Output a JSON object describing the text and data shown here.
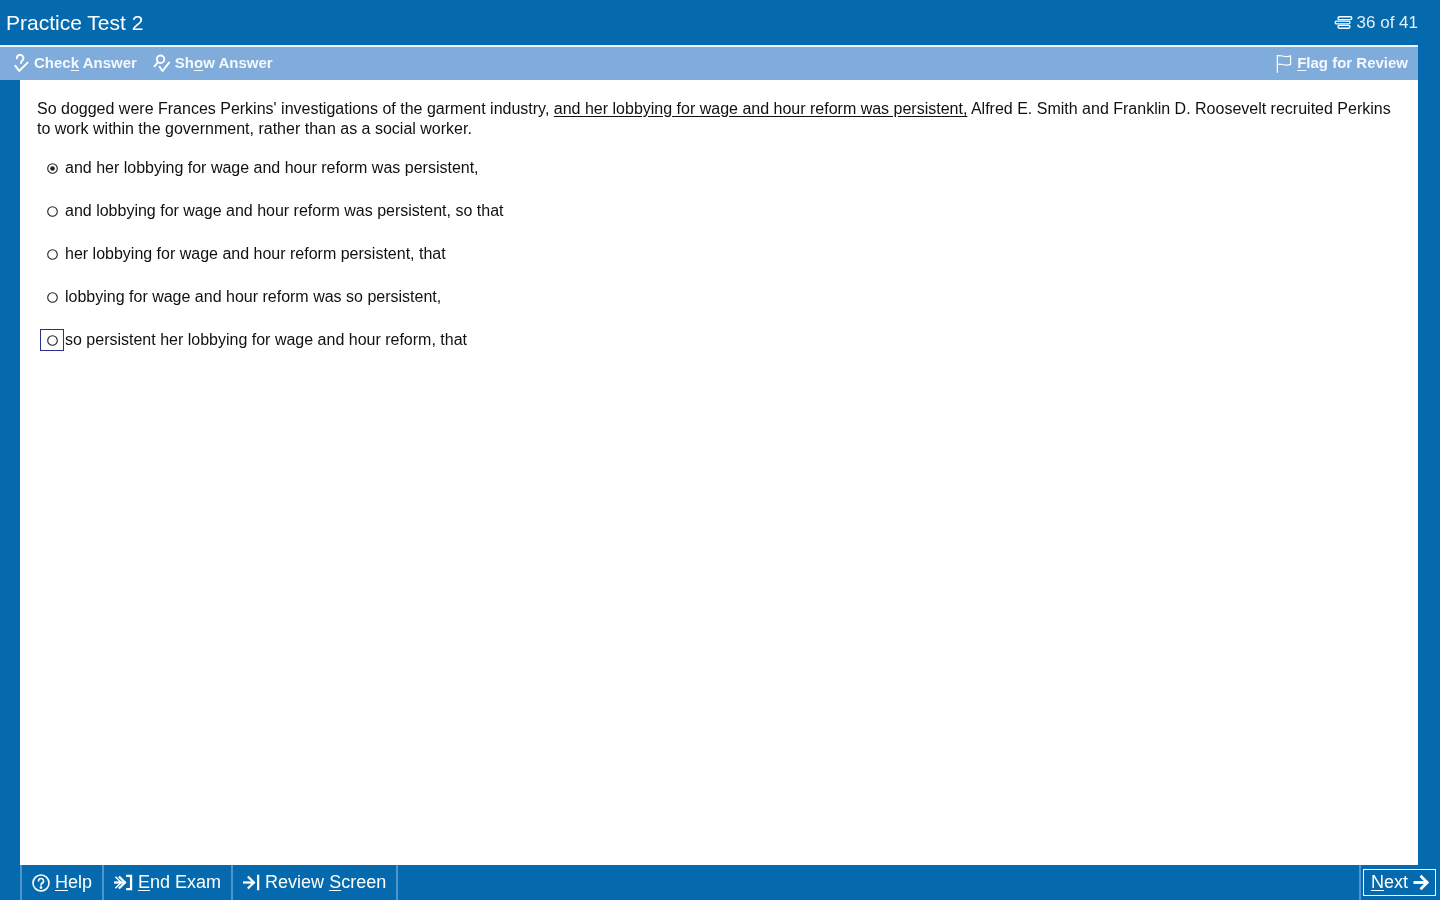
{
  "window": {
    "title": "Practice Test 2",
    "counter": "36 of 41"
  },
  "toolbar": {
    "left": [
      {
        "kind": "check",
        "label_parts": [
          {
            "text": "Chec",
            "underlined": false
          },
          {
            "text": "k",
            "underlined": true
          },
          {
            "text": " Answer",
            "underlined": false
          }
        ]
      },
      {
        "kind": "show",
        "label_parts": [
          {
            "text": "Sh",
            "underlined": false
          },
          {
            "text": "o",
            "underlined": true
          },
          {
            "text": "w Answer",
            "underlined": false
          }
        ]
      }
    ],
    "right": [
      {
        "kind": "flag",
        "label_parts": [
          {
            "text": "F",
            "underlined": true
          },
          {
            "text": "lag for Review",
            "underlined": false
          }
        ]
      }
    ]
  },
  "question": {
    "passage": [
      {
        "text": "So dogged were Frances Perkins' investigations of the garment industry, ",
        "underlined": false
      },
      {
        "text": "and her lobbying for wage and hour reform was persistent,",
        "underlined": true
      },
      {
        "text": " Alfred E. Smith and Franklin D. Roosevelt recruited Perkins to work within the government, rather than as a social worker.",
        "underlined": false
      }
    ],
    "choices": [
      {
        "text": "and her lobbying for wage and hour reform was persistent,",
        "selected": true,
        "focused": false
      },
      {
        "text": "and lobbying for wage and hour reform was persistent, so that",
        "selected": false,
        "focused": false
      },
      {
        "text": "her lobbying for wage and hour reform persistent, that",
        "selected": false,
        "focused": false
      },
      {
        "text": "lobbying for wage and hour reform was so persistent,",
        "selected": false,
        "focused": false
      },
      {
        "text": "so persistent her lobbying for wage and hour reform, that",
        "selected": false,
        "focused": true
      }
    ]
  },
  "footer": {
    "left": [
      {
        "kind": "help",
        "label_parts": [
          {
            "text": "H",
            "underlined": true
          },
          {
            "text": "elp",
            "underlined": false
          }
        ],
        "focused": false
      },
      {
        "kind": "end",
        "label_parts": [
          {
            "text": "E",
            "underlined": true
          },
          {
            "text": "nd Exam",
            "underlined": false
          }
        ],
        "focused": false
      },
      {
        "kind": "review",
        "label_parts": [
          {
            "text": "Review ",
            "underlined": false
          },
          {
            "text": "S",
            "underlined": true
          },
          {
            "text": "creen",
            "underlined": false
          }
        ],
        "focused": false
      }
    ],
    "right": [
      {
        "kind": "next",
        "label_parts": [
          {
            "text": "N",
            "underlined": true
          },
          {
            "text": "ext",
            "underlined": false
          }
        ],
        "focused": true
      }
    ]
  }
}
